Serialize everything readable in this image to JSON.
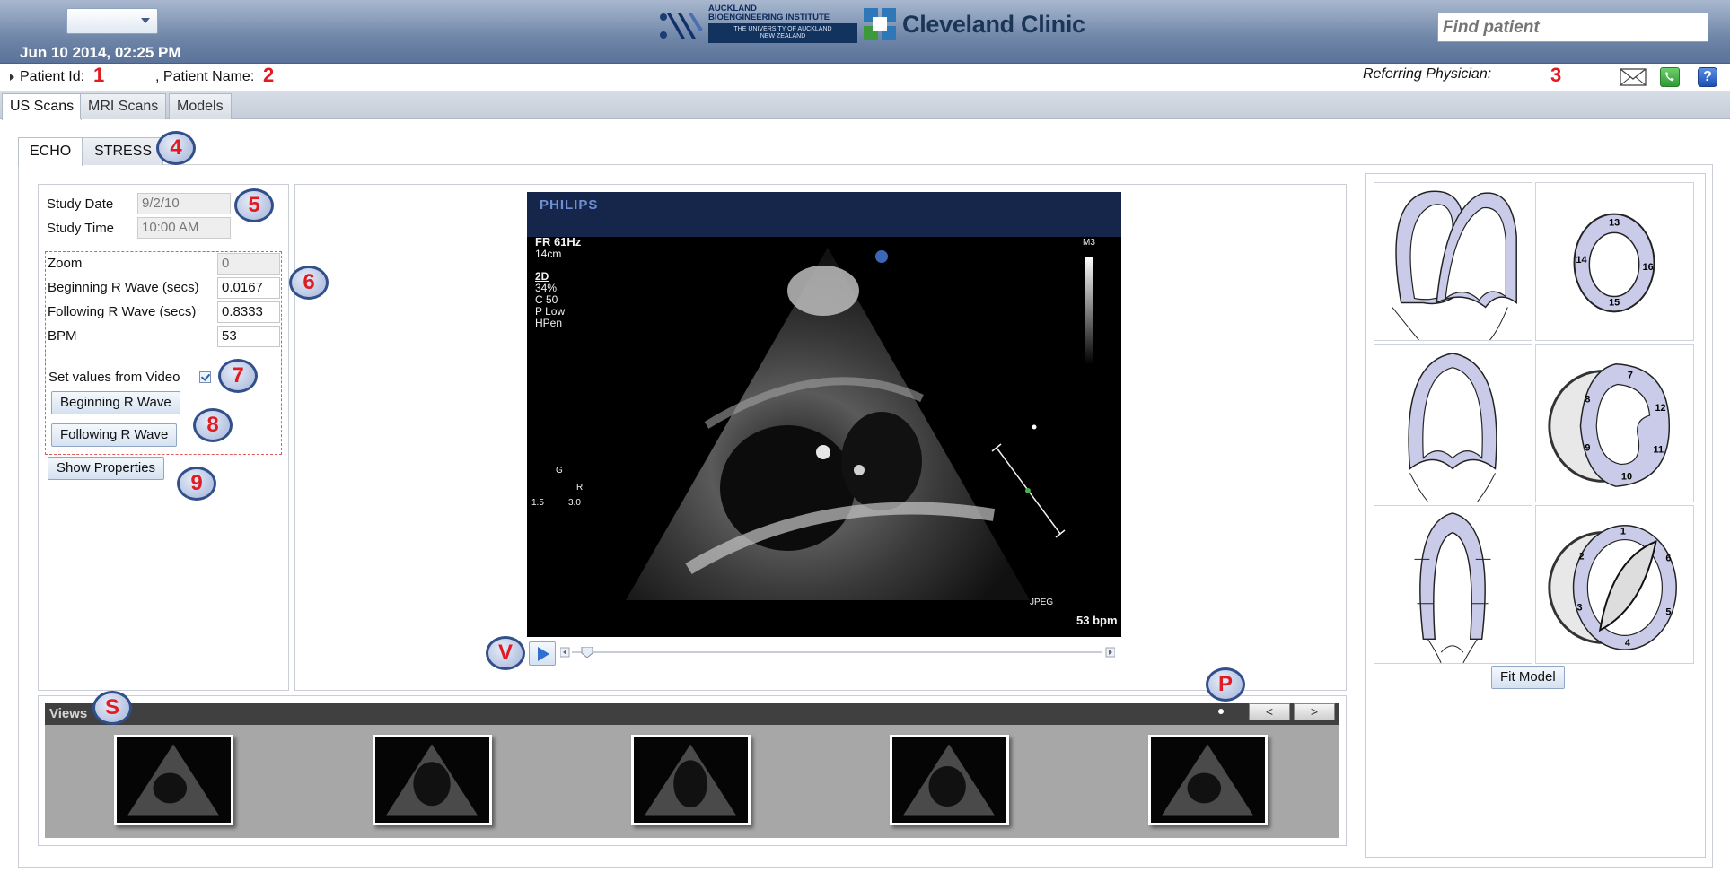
{
  "header": {
    "datetime": "Jun 10 2014, 02:25 PM",
    "auckland_line1": "AUCKLAND",
    "auckland_line2": "BIOENGINEERING INSTITUTE",
    "auckland_line3": "THE UNIVERSITY OF AUCKLAND",
    "auckland_line4": "NEW ZEALAND",
    "clinic_name": "Cleveland Clinic",
    "find_patient_placeholder": "Find patient"
  },
  "patient_bar": {
    "id_label": "Patient Id:",
    "name_label": ", Patient Name:",
    "referring_label": "Referring Physician:",
    "help_glyph": "?"
  },
  "top_tabs": [
    {
      "label": "US Scans",
      "active": true
    },
    {
      "label": "MRI Scans",
      "active": false
    },
    {
      "label": "Models",
      "active": false
    }
  ],
  "echo_tabs": [
    {
      "label": "ECHO",
      "active": true
    },
    {
      "label": "STRESS",
      "active": false
    }
  ],
  "study": {
    "date_label": "Study Date",
    "date_value": "9/2/10",
    "time_label": "Study Time",
    "time_value": "10:00 AM"
  },
  "properties": {
    "zoom_label": "Zoom",
    "zoom_value": "0",
    "begin_label": "Beginning R Wave (secs)",
    "begin_value": "0.0167",
    "follow_label": "Following R Wave (secs)",
    "follow_value": "0.8333",
    "bpm_label": "BPM",
    "bpm_value": "53",
    "set_from_video_label": "Set values from Video",
    "set_from_video_checked": true,
    "begin_button": "Beginning R Wave",
    "follow_button": "Following R Wave",
    "show_properties_button": "Show Properties"
  },
  "echo_image": {
    "brand": "PHILIPS",
    "frame_rate": "FR 61Hz",
    "depth": "14cm",
    "mode": "2D",
    "gain": " 34%",
    "compress": "C 50",
    "power": "P Low",
    "harmonic": "HPen",
    "m_label": "M3",
    "g_label": "G",
    "r_label": "R",
    "scale_left": "1.5",
    "scale_right": "3.0",
    "format": "JPEG",
    "bpm": "53 bpm"
  },
  "views": {
    "label": "Views",
    "prev": "<",
    "next": ">",
    "thumbnail_count": 5
  },
  "model": {
    "fit_button": "Fit Model",
    "segments_short_axis_base": [
      "13",
      "14",
      "15",
      "16"
    ],
    "segments_short_axis_mid": [
      "7",
      "8",
      "9",
      "10",
      "11",
      "12"
    ],
    "segments_short_axis_apex": [
      "1",
      "2",
      "3",
      "4",
      "5",
      "6"
    ]
  },
  "annotations": {
    "num1": "1",
    "num2": "2",
    "num3": "3",
    "c4": "4",
    "c5": "5",
    "c6": "6",
    "c7": "7",
    "c8": "8",
    "c9": "9",
    "cV": "V",
    "cS": "S",
    "cP": "P"
  },
  "colors": {
    "header_blue": "#6f86a8",
    "annotation_red": "#e01b22",
    "callout_border": "#314f8a",
    "model_fill": "#c9cbe8"
  }
}
